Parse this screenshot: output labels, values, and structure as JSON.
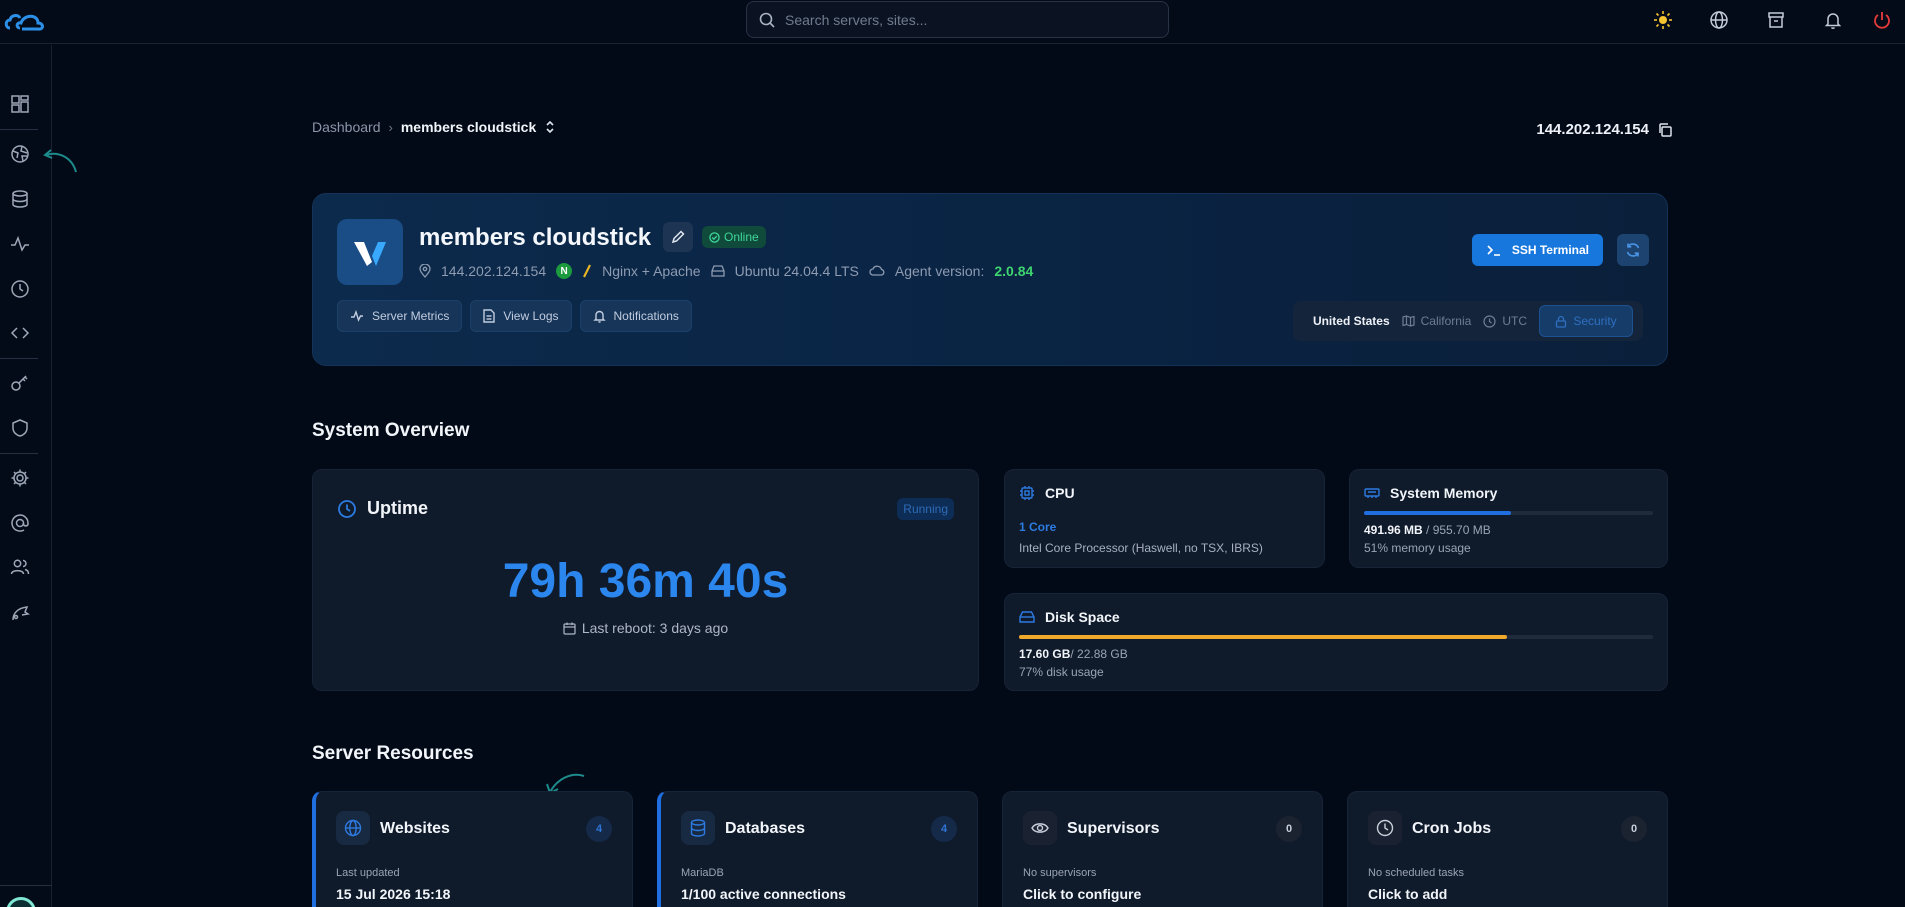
{
  "topbar": {
    "search_placeholder": "Search servers, sites..."
  },
  "breadcrumb": {
    "root": "Dashboard",
    "current": "members cloudstick"
  },
  "header_ip": "144.202.124.154",
  "server": {
    "name": "members cloudstick",
    "status": "Online",
    "ip": "144.202.124.154",
    "webserver": "Nginx + Apache",
    "n_badge": "N",
    "os": "Ubuntu 24.04.4 LTS",
    "agent_label": "Agent version:",
    "agent_version": "2.0.84",
    "actions": {
      "metrics": "Server Metrics",
      "logs": "View Logs",
      "notifications": "Notifications"
    },
    "ssh_label": "SSH Terminal",
    "location": {
      "country": "United States",
      "region": "California",
      "timezone": "UTC",
      "security": "Security"
    }
  },
  "overview": {
    "title": "System Overview",
    "uptime": {
      "title": "Uptime",
      "badge": "Running",
      "value": "79h 36m 40s",
      "last_reboot": "Last reboot: 3 days ago"
    },
    "cpu": {
      "title": "CPU",
      "cores": "1 Core",
      "model": "Intel Core Processor (Haswell, no TSX, IBRS)"
    },
    "memory": {
      "title": "System Memory",
      "used": "491.96 MB",
      "total": " / 955.70 MB",
      "usage_text": "51% memory usage",
      "fraction": 0.51,
      "color": "#1f6fe0"
    },
    "disk": {
      "title": "Disk Space",
      "used": "17.60 GB",
      "total": "/ 22.88 GB",
      "usage_text": "77% disk usage",
      "fraction": 0.77,
      "color": "#f0a92a"
    }
  },
  "resources": {
    "title": "Server Resources",
    "websites": {
      "title": "Websites",
      "count": "4",
      "sub": "Last updated",
      "main": "15 Jul 2026 15:18"
    },
    "databases": {
      "title": "Databases",
      "count": "4",
      "sub": "MariaDB",
      "main": "1/100 active connections"
    },
    "supervisors": {
      "title": "Supervisors",
      "count": "0",
      "sub": "No supervisors",
      "main": "Click to configure"
    },
    "cron": {
      "title": "Cron Jobs",
      "count": "0",
      "sub": "No scheduled tasks",
      "main": "Click to add"
    }
  },
  "colors": {
    "accent": "#1f6fe0",
    "online": "#3fd79a",
    "agent": "#3fd46f",
    "danger": "#e53b3b"
  }
}
